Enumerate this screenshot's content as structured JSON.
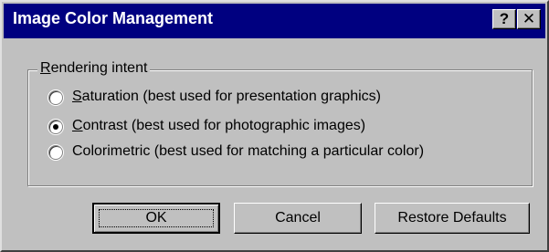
{
  "window": {
    "title": "Image Color Management",
    "help_label": "?",
    "close_label": "✕"
  },
  "group": {
    "label": "Rendering intent"
  },
  "options": [
    {
      "label": "Saturation (best used for presentation graphics)",
      "checked": false
    },
    {
      "label": "Contrast (best used for photographic images)",
      "checked": true
    },
    {
      "label": "Colorimetric (best used for matching a particular color)",
      "checked": false
    }
  ],
  "buttons": {
    "ok": "OK",
    "cancel": "Cancel",
    "restore": "Restore Defaults"
  },
  "colors": {
    "titlebar": "#000080",
    "face": "#c0c0c0"
  }
}
